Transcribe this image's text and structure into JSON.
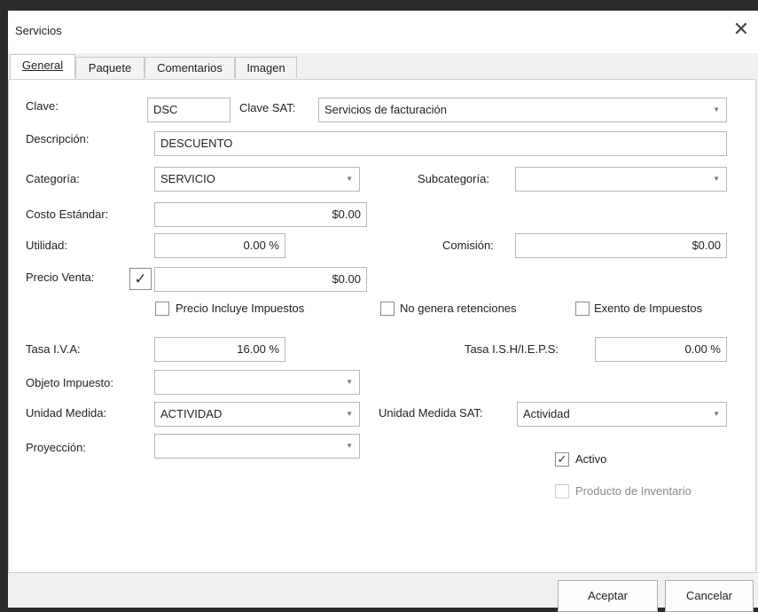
{
  "window": {
    "title": "Servicios",
    "close_symbol": "✕"
  },
  "tabs": [
    "General",
    "Paquete",
    "Comentarios",
    "Imagen"
  ],
  "form": {
    "clave_label": "Clave:",
    "clave_value": "DSC",
    "clave_sat_label": "Clave SAT:",
    "clave_sat_value": "Servicios de facturación",
    "descripcion_label": "Descripción:",
    "descripcion_value": "DESCUENTO",
    "categoria_label": "Categoría:",
    "categoria_value": "SERVICIO",
    "subcategoria_label": "Subcategoría:",
    "subcategoria_value": "",
    "costo_label": "Costo Estándar:",
    "costo_value": "$0.00",
    "utilidad_label": "Utilidad:",
    "utilidad_value": "0.00 %",
    "comision_label": "Comisión:",
    "comision_value": "$0.00",
    "precio_label": "Precio Venta:",
    "precio_checked": true,
    "precio_value": "$0.00",
    "precio_incluye_label": "Precio Incluye Impuestos",
    "precio_incluye_checked": false,
    "no_genera_label": "No genera retenciones",
    "no_genera_checked": false,
    "exento_label": "Exento de Impuestos",
    "exento_checked": false,
    "tasa_iva_label": "Tasa I.V.A:",
    "tasa_iva_value": "16.00 %",
    "tasa_ish_label": "Tasa I.S.H/I.E.P.S:",
    "tasa_ish_value": "0.00 %",
    "objeto_label": "Objeto Impuesto:",
    "objeto_value": "",
    "unidad_label": "Unidad Medida:",
    "unidad_value": "ACTIVIDAD",
    "unidad_sat_label": "Unidad Medida SAT:",
    "unidad_sat_value": "Actividad",
    "proyeccion_label": "Proyección:",
    "proyeccion_value": "",
    "activo_label": "Activo",
    "activo_checked": true,
    "inventario_label": "Producto de Inventario",
    "inventario_checked": false,
    "inventario_enabled": false
  },
  "icons": {
    "check": "✓",
    "dropdown": "▼",
    "dropdown_icon": "chevron-down-icon"
  },
  "buttons": {
    "accept": "Aceptar",
    "cancel": "Cancelar"
  }
}
